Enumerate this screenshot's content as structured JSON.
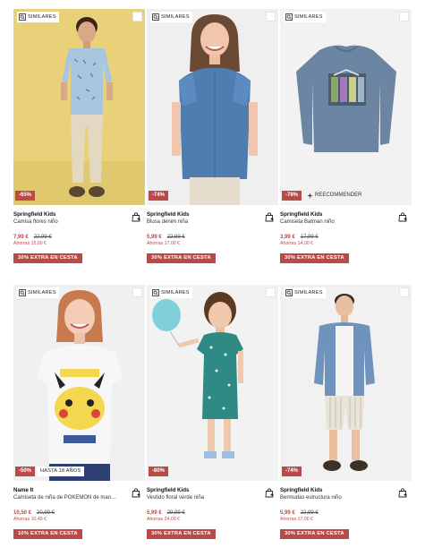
{
  "similar_label": "SIMILARES",
  "products": [
    {
      "brand": "Springfield Kids",
      "name": "Camisa flores niño",
      "price": "7,99 €",
      "old_price": "22,99 €",
      "savings": "Ahorras 15,00 €",
      "discount": "-65%",
      "promo": "30% EXTRA EN CESTA",
      "badge": ""
    },
    {
      "brand": "Springfield Kids",
      "name": "Blusa denim niña",
      "price": "5,99 €",
      "old_price": "22,99 €",
      "savings": "Ahorras 17,00 €",
      "discount": "-74%",
      "promo": "30% EXTRA EN CESTA",
      "badge": ""
    },
    {
      "brand": "Springfield Kids",
      "name": "Camiseta Batman niño",
      "price": "3,99 €",
      "old_price": "17,99 €",
      "savings": "Ahorras 14,00 €",
      "discount": "-78%",
      "promo": "30% EXTRA EN CESTA",
      "badge": "RECOMMENDED",
      "sponsor": "REECOMMENDER"
    },
    {
      "brand": "Name It",
      "name": "Camiseta de niña de POKEMON de manga c...",
      "price": "10,50 €",
      "old_price": "20,99 €",
      "savings": "Ahorras 10,49 €",
      "discount": "-50%",
      "promo": "10% EXTRA EN CESTA",
      "badge": "HASTA 18 AÑOS"
    },
    {
      "brand": "Springfield Kids",
      "name": "Vestido floral verde niña",
      "price": "5,99 €",
      "old_price": "29,99 €",
      "savings": "Ahorras 24,00 €",
      "discount": "-80%",
      "promo": "30% EXTRA EN CESTA",
      "badge": ""
    },
    {
      "brand": "Springfield Kids",
      "name": "Bermudas estructura niño",
      "price": "5,99 €",
      "old_price": "22,99 €",
      "savings": "Ahorras 17,00 €",
      "discount": "-74%",
      "promo": "30% EXTRA EN CESTA",
      "badge": ""
    }
  ],
  "colors": {
    "accent": "#b94a48",
    "photo_bg_yellow": "#e9d27a",
    "photo_bg_grey": "#eeeeee"
  }
}
